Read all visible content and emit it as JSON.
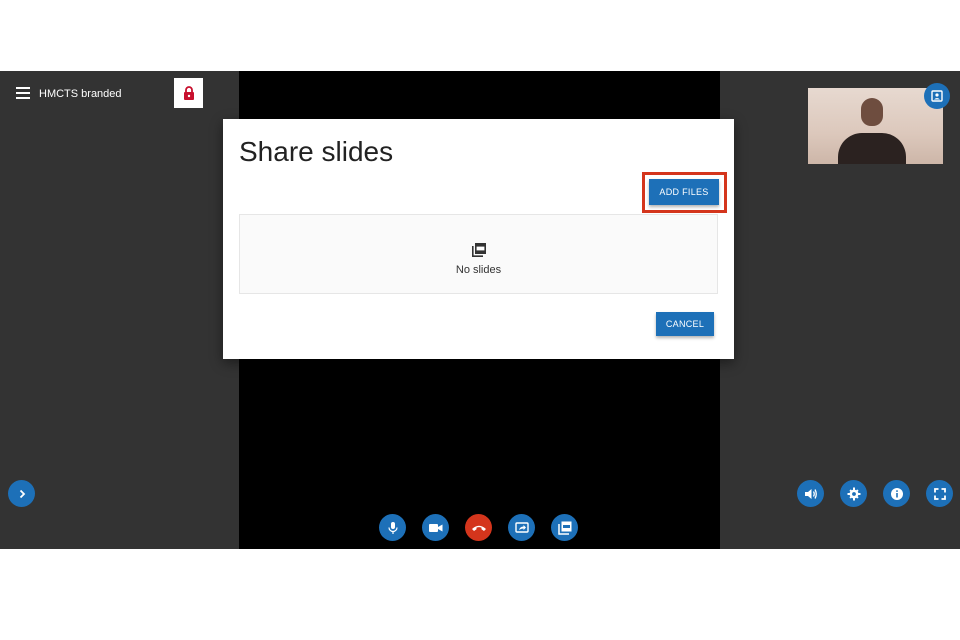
{
  "header": {
    "room_title": "HMCTS branded",
    "menu_icon": "hamburger-menu-icon",
    "lock_icon": "padlock-icon"
  },
  "dialog": {
    "title": "Share slides",
    "add_files_label": "ADD FILES",
    "empty_icon": "pdf-stack-icon",
    "empty_text": "No slides",
    "cancel_label": "CANCEL"
  },
  "controls": {
    "side_panel_icon": "chevron-right-icon",
    "bottom": [
      "microphone-icon",
      "video-camera-icon",
      "hang-up-icon",
      "share-screen-icon",
      "share-slides-icon"
    ],
    "right": [
      "volume-icon",
      "settings-icon",
      "info-icon",
      "fullscreen-icon"
    ],
    "self_view_icon": "contact-portrait-icon"
  },
  "colors": {
    "accent": "#1d70b8",
    "danger": "#d4351c",
    "highlight": "#d4351c",
    "panel": "#333333",
    "stage": "#000000"
  }
}
